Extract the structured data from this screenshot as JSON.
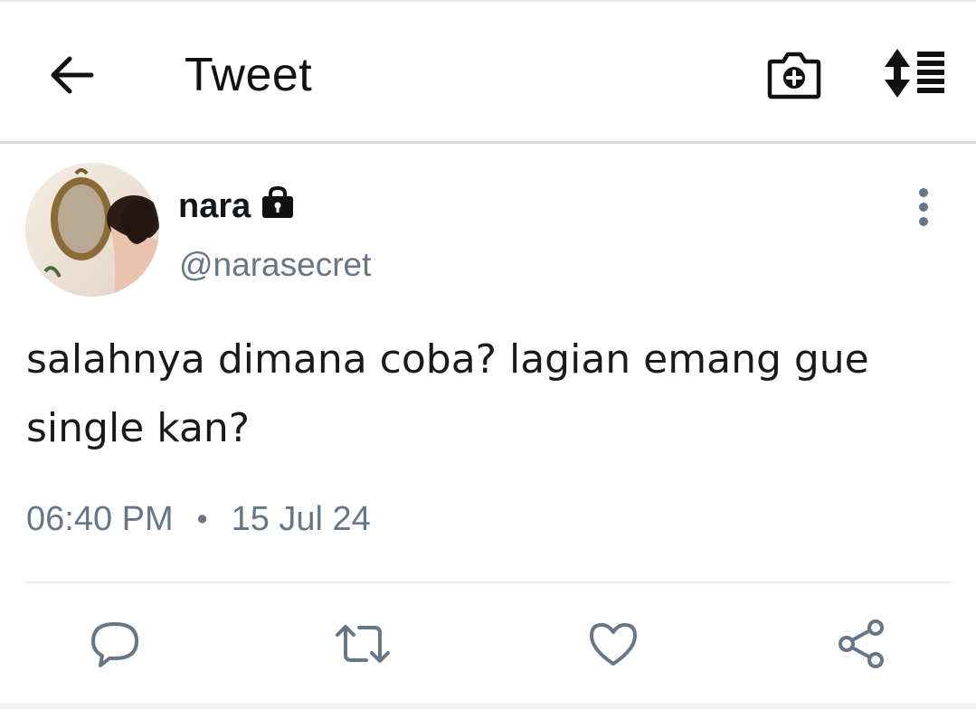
{
  "header": {
    "title": "Tweet",
    "icons": {
      "back": "back-arrow-icon",
      "camera": "camera-add-icon",
      "sort": "sort-list-icon"
    }
  },
  "tweet": {
    "author": {
      "name": "nara",
      "handle": "@narasecret",
      "protected_icon": "lock-icon"
    },
    "text_line1": "salahnya dimana coba? lagian emang gue",
    "text_line2": "single kan?",
    "time": "06:40 PM",
    "separator": "•",
    "date": "15 Jul 24",
    "more_icon": "more-vertical-icon"
  },
  "actions": {
    "reply_icon": "reply-icon",
    "retweet_icon": "retweet-icon",
    "like_icon": "heart-icon",
    "share_icon": "share-icon"
  },
  "colors": {
    "text_primary": "#14171a",
    "text_secondary": "#657786",
    "icon_gray": "#657786",
    "divider": "#e6ecf0"
  }
}
